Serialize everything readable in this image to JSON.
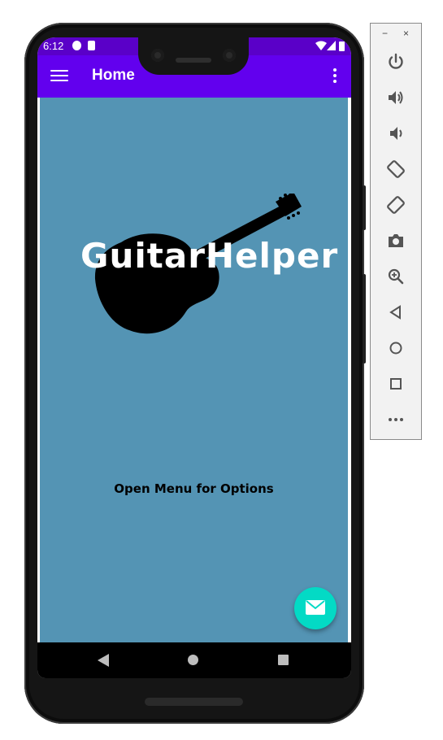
{
  "status_bar": {
    "time": "6:12",
    "icons": [
      "notification-icon",
      "sd-card-icon",
      "wifi-icon",
      "signal-icon",
      "battery-icon"
    ]
  },
  "app_bar": {
    "title": "Home",
    "nav_icon": "hamburger-menu-icon",
    "overflow_icon": "more-vert-icon",
    "color": "#6200ee",
    "status_color": "#5a00c8"
  },
  "content": {
    "logo_text": "GuitarHelper",
    "logo_icon": "guitar-icon",
    "prompt": "Open Menu for Options",
    "background": "#5494b4"
  },
  "fab": {
    "icon": "email-icon",
    "color": "#03dac5"
  },
  "nav_bar": {
    "back": "back-icon",
    "home": "home-icon",
    "recents": "recents-icon"
  },
  "emulator_panel": {
    "window_controls": [
      "−",
      "×"
    ],
    "buttons": [
      "power",
      "volume-up",
      "volume-down",
      "rotate-left",
      "rotate-right",
      "screenshot",
      "zoom",
      "back",
      "home",
      "overview",
      "more"
    ]
  }
}
